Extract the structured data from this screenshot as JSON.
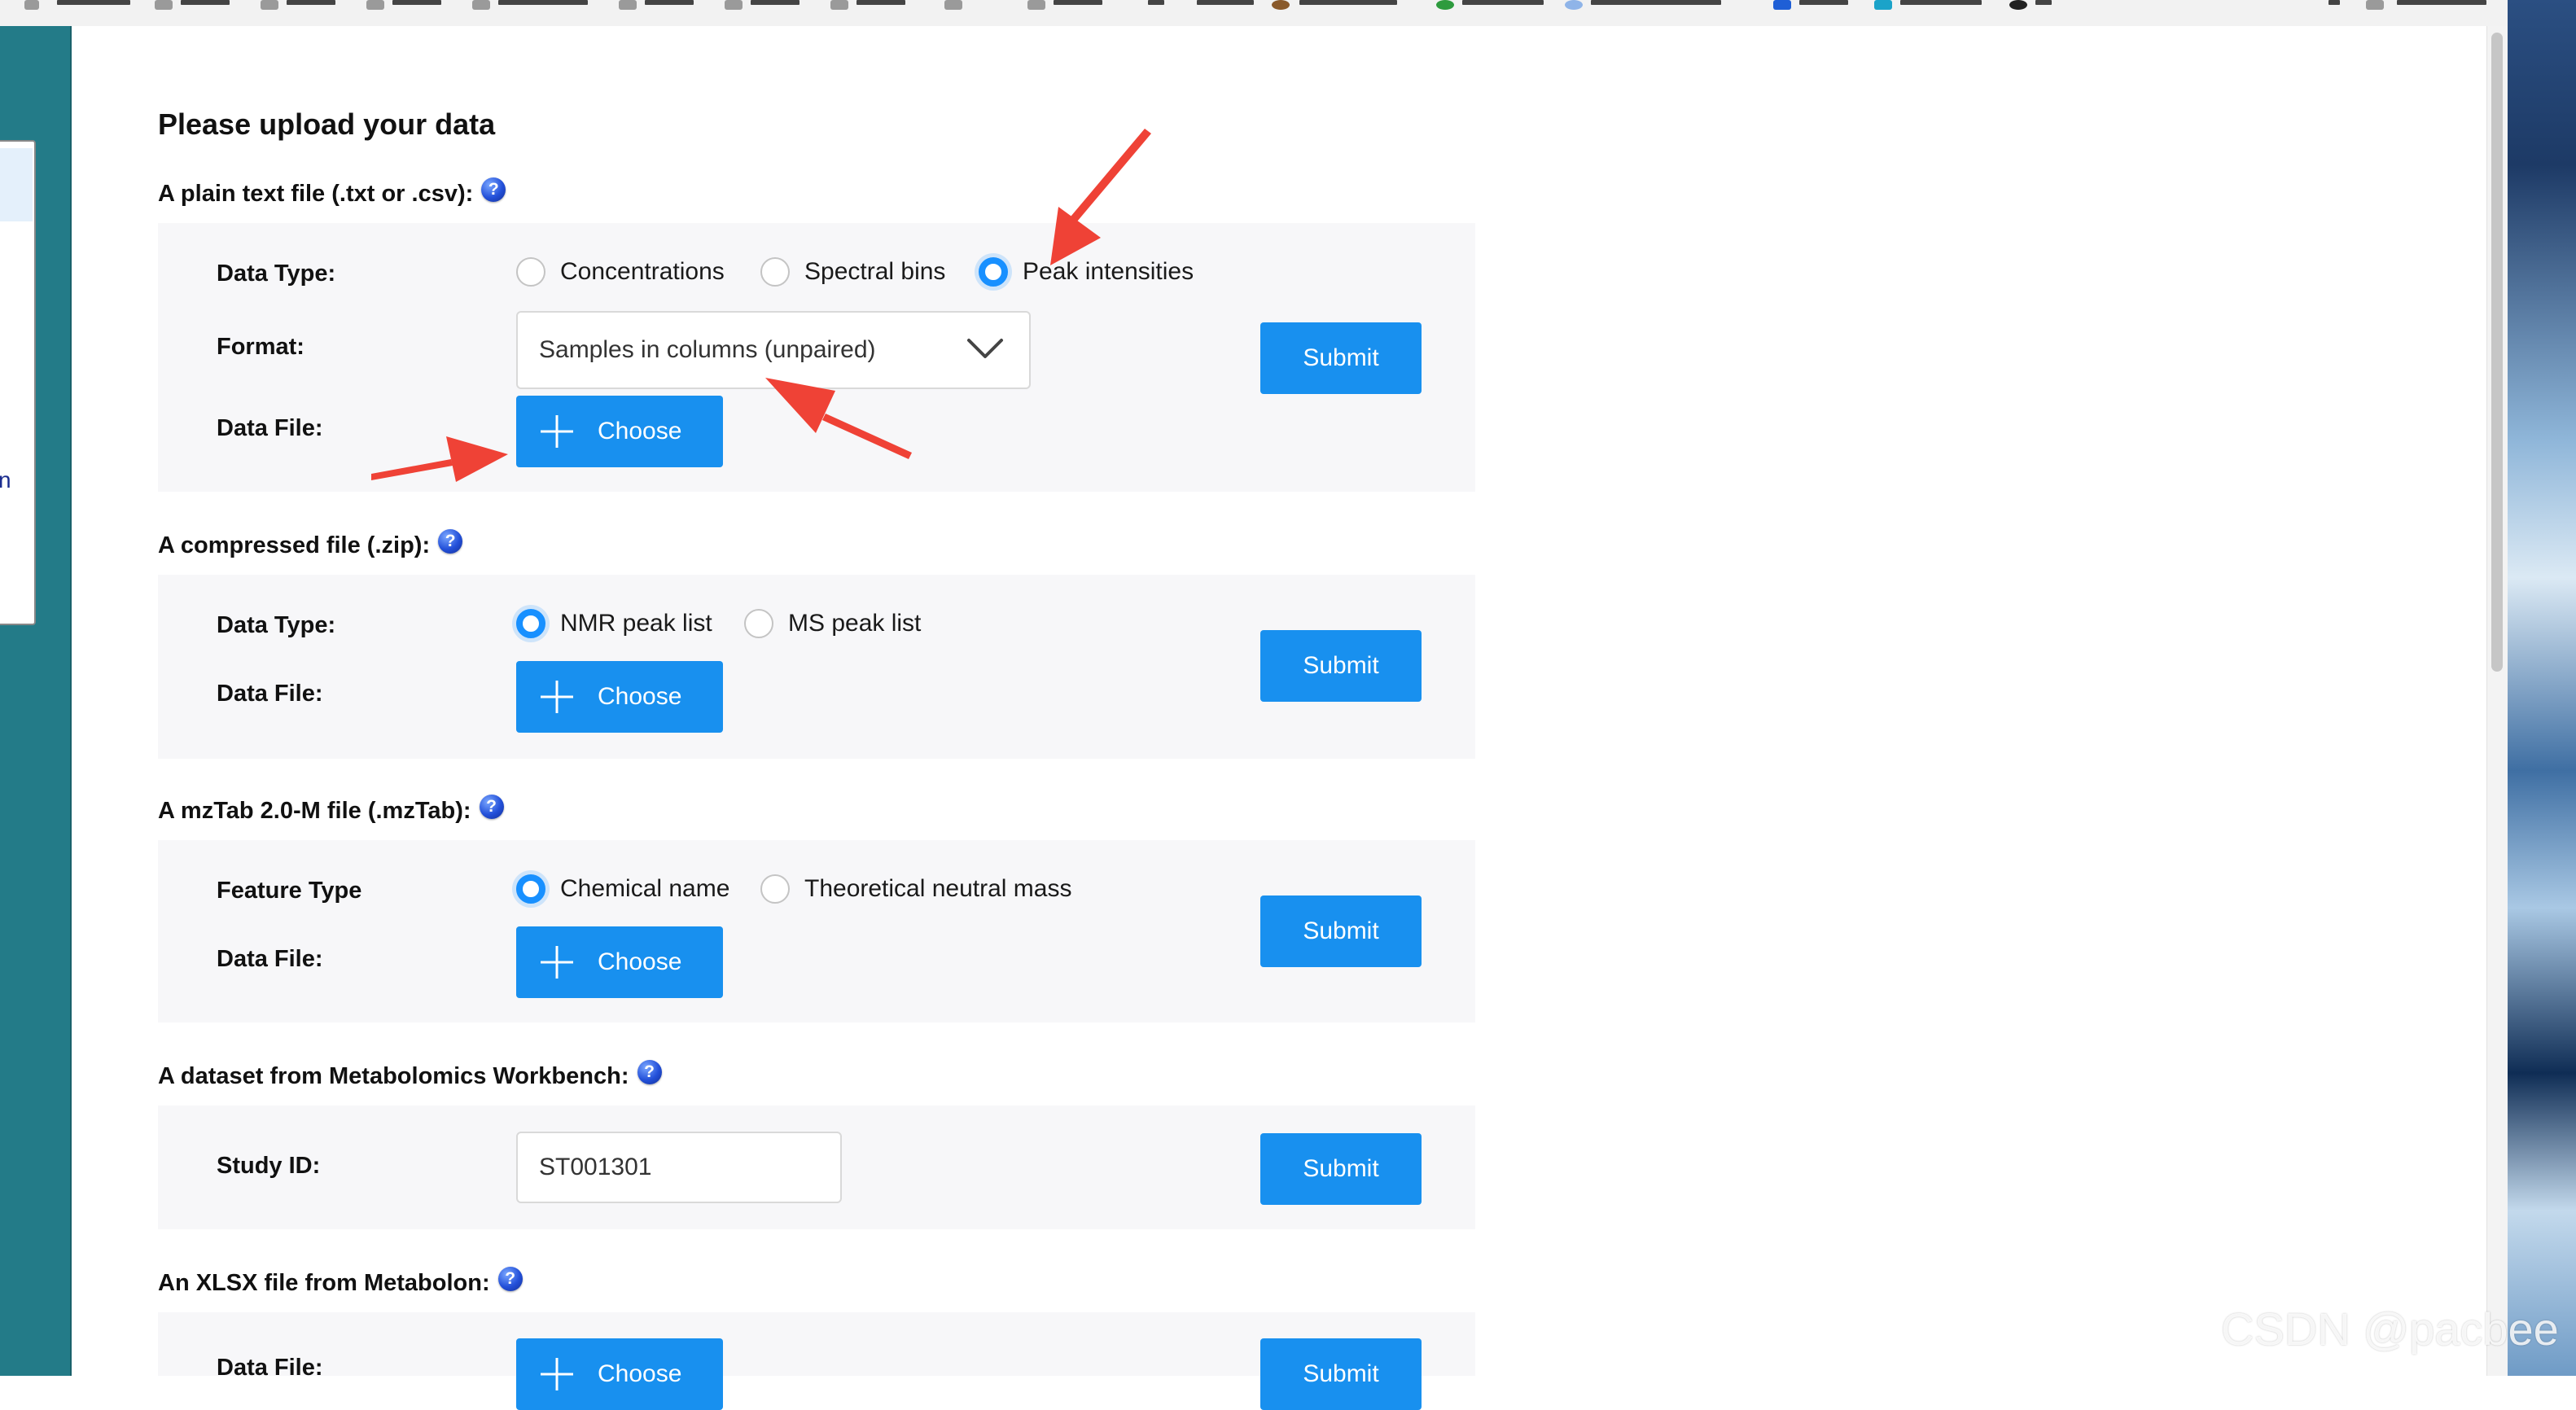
{
  "page": {
    "title": "Please upload your data"
  },
  "sections": {
    "plain": {
      "heading": "A plain text file (.txt or .csv):",
      "data_type_label": "Data Type:",
      "options": [
        "Concentrations",
        "Spectral bins",
        "Peak intensities"
      ],
      "selected_option": "Peak intensities",
      "format_label": "Format:",
      "format_value": "Samples in columns (unpaired)",
      "data_file_label": "Data File:",
      "choose_label": "Choose",
      "submit_label": "Submit"
    },
    "zip": {
      "heading": "A compressed file (.zip):",
      "data_type_label": "Data Type:",
      "options": [
        "NMR peak list",
        "MS peak list"
      ],
      "selected_option": "NMR peak list",
      "data_file_label": "Data File:",
      "choose_label": "Choose",
      "submit_label": "Submit"
    },
    "mztab": {
      "heading": "A mzTab 2.0-M file (.mzTab):",
      "feature_type_label": "Feature Type",
      "options": [
        "Chemical name",
        "Theoretical neutral mass"
      ],
      "selected_option": "Chemical name",
      "data_file_label": "Data File:",
      "choose_label": "Choose",
      "submit_label": "Submit"
    },
    "workbench": {
      "heading": "A dataset from Metabolomics Workbench:",
      "study_id_label": "Study ID:",
      "study_id_value": "ST001301",
      "submit_label": "Submit"
    },
    "xlsx": {
      "heading": "An XLSX file from Metabolon:",
      "data_file_label": "Data File:",
      "choose_label": "Choose",
      "submit_label": "Submit"
    }
  },
  "help_icon_glyph": "?",
  "sidebar_fragment_text": "n",
  "watermark": "CSDN @pacbee",
  "colors": {
    "accent": "#1890ef",
    "annotation_arrow": "#ef4236",
    "sidebar": "#237b88",
    "panel_bg": "#f7f7f9"
  },
  "icons": [
    "help-icon",
    "plus-icon",
    "chevron-down-icon",
    "annotation-arrow"
  ]
}
